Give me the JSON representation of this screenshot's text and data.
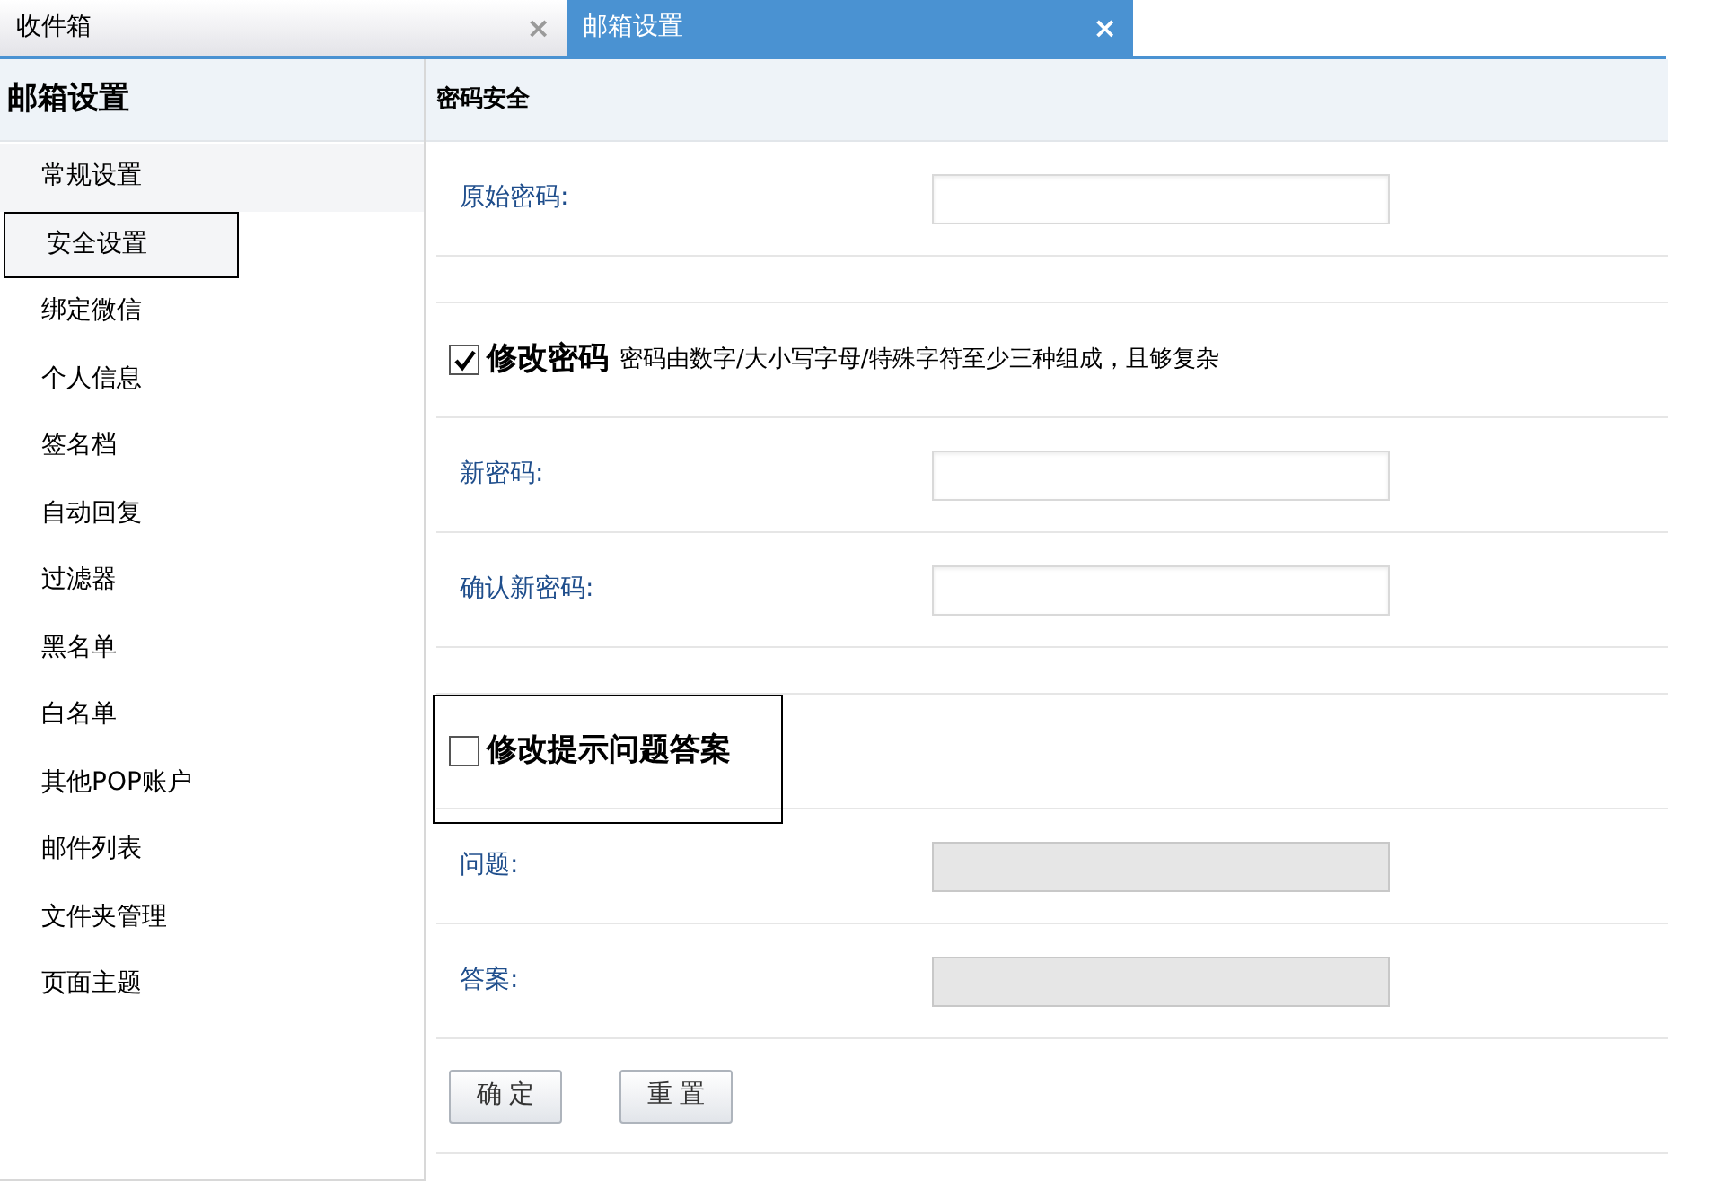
{
  "tabs": [
    {
      "label": "收件箱",
      "close": "×",
      "selected": false
    },
    {
      "label": "邮箱设置",
      "close": "×",
      "selected": true
    }
  ],
  "sidebar": {
    "title": "邮箱设置",
    "items": [
      {
        "label": "常规设置",
        "selected": false
      },
      {
        "label": "安全设置",
        "selected": true
      },
      {
        "label": "绑定微信",
        "selected": false
      },
      {
        "label": "个人信息",
        "selected": false
      },
      {
        "label": "签名档",
        "selected": false
      },
      {
        "label": "自动回复",
        "selected": false
      },
      {
        "label": "过滤器",
        "selected": false
      },
      {
        "label": "黑名单",
        "selected": false
      },
      {
        "label": "白名单",
        "selected": false
      },
      {
        "label": "其他POP账户",
        "selected": false
      },
      {
        "label": "邮件列表",
        "selected": false
      },
      {
        "label": "文件夹管理",
        "selected": false
      },
      {
        "label": "页面主题",
        "selected": false
      }
    ]
  },
  "section": {
    "title": "密码安全"
  },
  "rows": [
    {
      "kind": "field",
      "label": "原始密码:",
      "disabled": false
    },
    {
      "kind": "spacer"
    },
    {
      "kind": "check",
      "label": "修改密码",
      "hint": "密码由数字/大小写字母/特殊字符至少三种组成，且够复杂",
      "checked": true,
      "outlined": false
    },
    {
      "kind": "field",
      "label": "新密码:",
      "disabled": false
    },
    {
      "kind": "field",
      "label": "确认新密码:",
      "disabled": false
    },
    {
      "kind": "spacer"
    },
    {
      "kind": "check",
      "label": "修改提示问题答案",
      "checked": false,
      "outlined": true
    },
    {
      "kind": "field",
      "label": "问题:",
      "disabled": true
    },
    {
      "kind": "field",
      "label": "答案:",
      "disabled": true
    }
  ],
  "buttons": [
    "确 定",
    "重 置"
  ]
}
